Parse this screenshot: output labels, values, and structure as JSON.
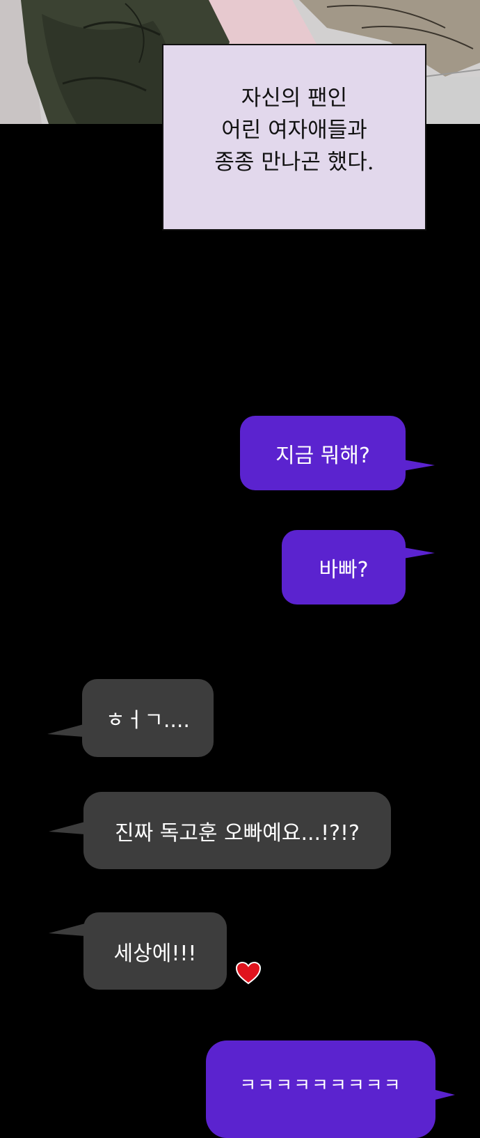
{
  "narration": {
    "text": "자신의 팬인\n어린 여자애들과\n종종 만나곤 했다."
  },
  "messages": [
    {
      "side": "right",
      "text": "지금 뭐해?"
    },
    {
      "side": "right",
      "text": "바빠?"
    },
    {
      "side": "left",
      "text": "ㅎㅓㄱ...."
    },
    {
      "side": "left",
      "text": "진짜 독고훈 오빠예요...!?!?"
    },
    {
      "side": "left",
      "text": "세상에!!!"
    },
    {
      "side": "right",
      "text": "ㅋㅋㅋㅋㅋㅋㅋㅋㅋ"
    }
  ],
  "colors": {
    "sent_bubble": "#5b23cf",
    "received_bubble": "#3d3d3d",
    "narration_box": "#e2d8ec",
    "background": "#000000",
    "heart": "#e0141e"
  },
  "decorations": {
    "heart_icon": "heart-icon"
  }
}
